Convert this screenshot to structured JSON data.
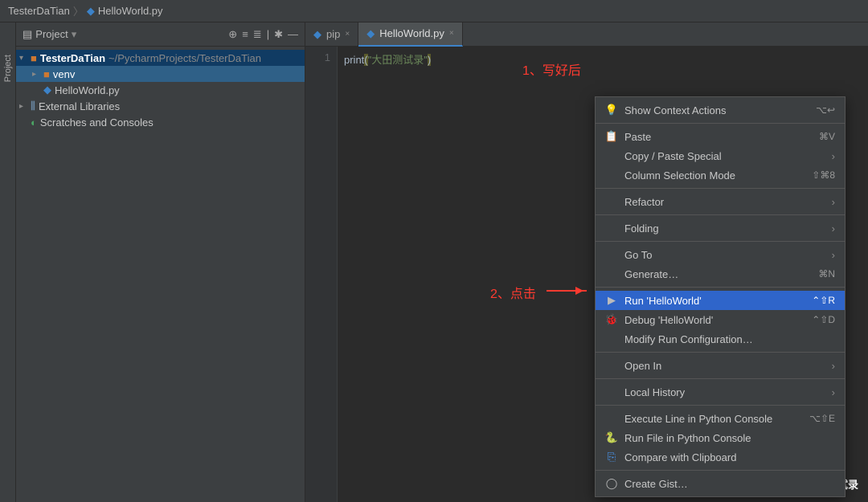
{
  "breadcrumb": {
    "parts": [
      "TesterDaTian",
      "HelloWorld.py"
    ]
  },
  "panel": {
    "title": "Project",
    "tree": {
      "root": {
        "name": "TesterDaTian",
        "path": "~/PycharmProjects/TesterDaTian"
      },
      "venv": "venv",
      "file": "HelloWorld.py",
      "ext": "External Libraries",
      "scratch": "Scratches and Consoles"
    }
  },
  "rail": {
    "label": "Project"
  },
  "tabs": {
    "t1": "pip",
    "t2": "HelloWorld.py"
  },
  "code": {
    "line_no": "1",
    "func": "print",
    "open": "(",
    "string": "\"大田测试录\"",
    "close": ")"
  },
  "anno": {
    "a1": "1、写好后",
    "a2": "2、点击"
  },
  "ctx": {
    "show_ctx": "Show Context Actions",
    "sc_show": "⌥↩",
    "paste": "Paste",
    "sc_paste": "⌘V",
    "copy_special": "Copy / Paste Special",
    "col_sel": "Column Selection Mode",
    "sc_col": "⇧⌘8",
    "refactor": "Refactor",
    "folding": "Folding",
    "goto": "Go To",
    "generate": "Generate…",
    "sc_gen": "⌘N",
    "run": "Run 'HelloWorld'",
    "sc_run": "⌃⇧R",
    "debug": "Debug 'HelloWorld'",
    "sc_debug": "⌃⇧D",
    "modify": "Modify Run Configuration…",
    "open_in": "Open In",
    "history": "Local History",
    "exec": "Execute Line in Python Console",
    "sc_exec": "⌥⇧E",
    "runfile": "Run File in Python Console",
    "compare": "Compare with Clipboard",
    "gist": "Create Gist…"
  },
  "watermark": "大田测试录"
}
